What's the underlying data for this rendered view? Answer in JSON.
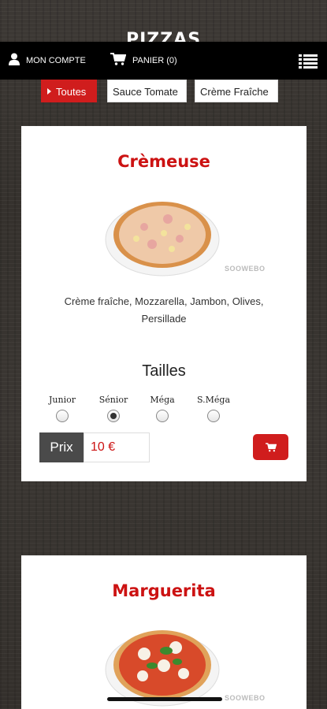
{
  "page_title": "PIZZAS",
  "topbar": {
    "account_label": "MON COMPTE",
    "cart_label": "PANIER (0)"
  },
  "filters": [
    {
      "label": "Toutes",
      "active": true
    },
    {
      "label": "Sauce Tomate",
      "active": false
    },
    {
      "label": "Crème Fraîche",
      "active": false
    }
  ],
  "products": [
    {
      "name": "Crèmeuse",
      "description": "Crème fraîche, Mozzarella, Jambon, Olives, Persillade",
      "watermark": "SOOWEBO",
      "sizes_title": "Tailles",
      "sizes": [
        {
          "label": "Junior",
          "checked": false
        },
        {
          "label": "Sénior",
          "checked": true
        },
        {
          "label": "Méga",
          "checked": false
        },
        {
          "label": "S.Méga",
          "checked": false
        }
      ],
      "price_label": "Prix",
      "price_value": "10 €"
    },
    {
      "name": "Marguerita",
      "watermark": "SOOWEBO"
    }
  ],
  "colors": {
    "accent": "#d01d1d",
    "title_red": "#cc1212",
    "topbar": "#000000"
  },
  "icons": {
    "account": "user-icon",
    "cart": "cart-icon",
    "menu": "list-menu-icon"
  }
}
